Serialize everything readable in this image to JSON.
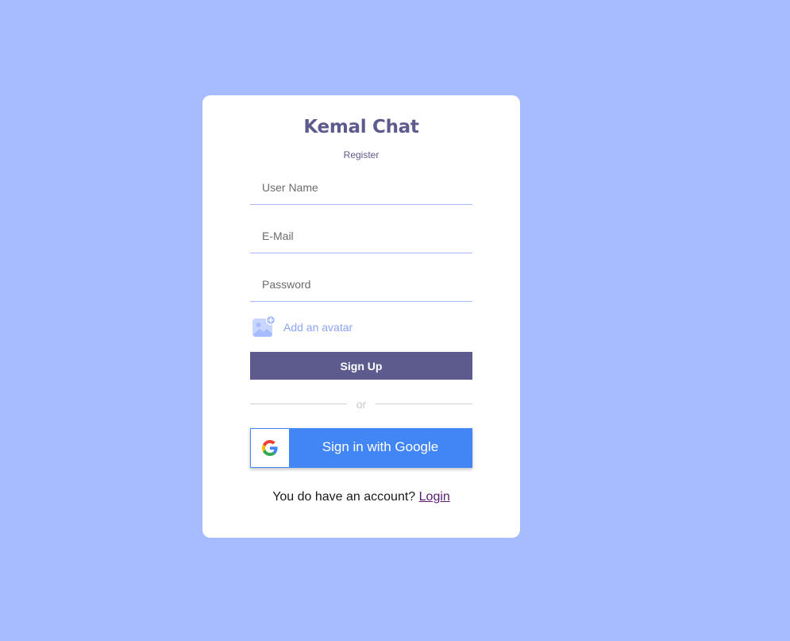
{
  "app": {
    "title": "Kemal Chat",
    "subtitle": "Register"
  },
  "form": {
    "username_placeholder": "User Name",
    "email_placeholder": "E-Mail",
    "password_placeholder": "Password",
    "username_value": "",
    "email_value": "",
    "password_value": "",
    "avatar_label": "Add an avatar",
    "avatar_icon": "add-image-icon",
    "signup_label": "Sign Up"
  },
  "divider": {
    "text": "or"
  },
  "google": {
    "label": "Sign in with Google",
    "icon": "google-logo-icon"
  },
  "footer": {
    "text": "You do have an account?",
    "link": "Login"
  },
  "colors": {
    "background": "#a7bcff",
    "brand": "#5d5b8d",
    "accent": "#8da4f1",
    "google_blue": "#4285f4",
    "link": "#5b1a6e"
  }
}
